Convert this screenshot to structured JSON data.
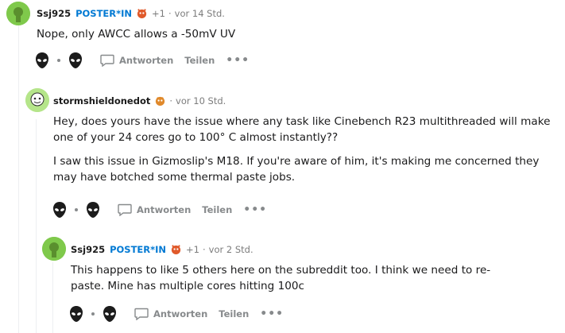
{
  "comments": [
    {
      "username": "Ssj925",
      "flair": "POSTER*IN",
      "score": "+1",
      "time": "vor 14 Std.",
      "body": [
        "Nope, only AWCC allows a -50mV UV"
      ],
      "reply_label": "Antworten",
      "share_label": "Teilen",
      "more_label": "•••",
      "avatar_color": "#7fc94b",
      "emoji_color": "#e05a2b"
    },
    {
      "username": "stormshieldonedot",
      "time": "vor 10 Std.",
      "body": [
        "Hey, does yours have the issue where any task like Cinebench R23 multithreaded will make one of your 24 cores go to 100° C almost instantly??",
        "I saw this issue in Gizmoslip's M18. If you're aware of him, it's making me concerned they may have botched some thermal paste jobs."
      ],
      "reply_label": "Antworten",
      "share_label": "Teilen",
      "more_label": "•••",
      "avatar_color": "#b5e58a",
      "emoji_color": "#e0892b"
    },
    {
      "username": "Ssj925",
      "flair": "POSTER*IN",
      "score": "+1",
      "time": "vor 2 Std.",
      "body": [
        "This happens to like 5 others here on the subreddit too. I think we need to re-paste. Mine has multiple cores hitting 100c"
      ],
      "reply_label": "Antworten",
      "share_label": "Teilen",
      "more_label": "•••",
      "avatar_color": "#7fc94b",
      "emoji_color": "#e05a2b"
    }
  ]
}
